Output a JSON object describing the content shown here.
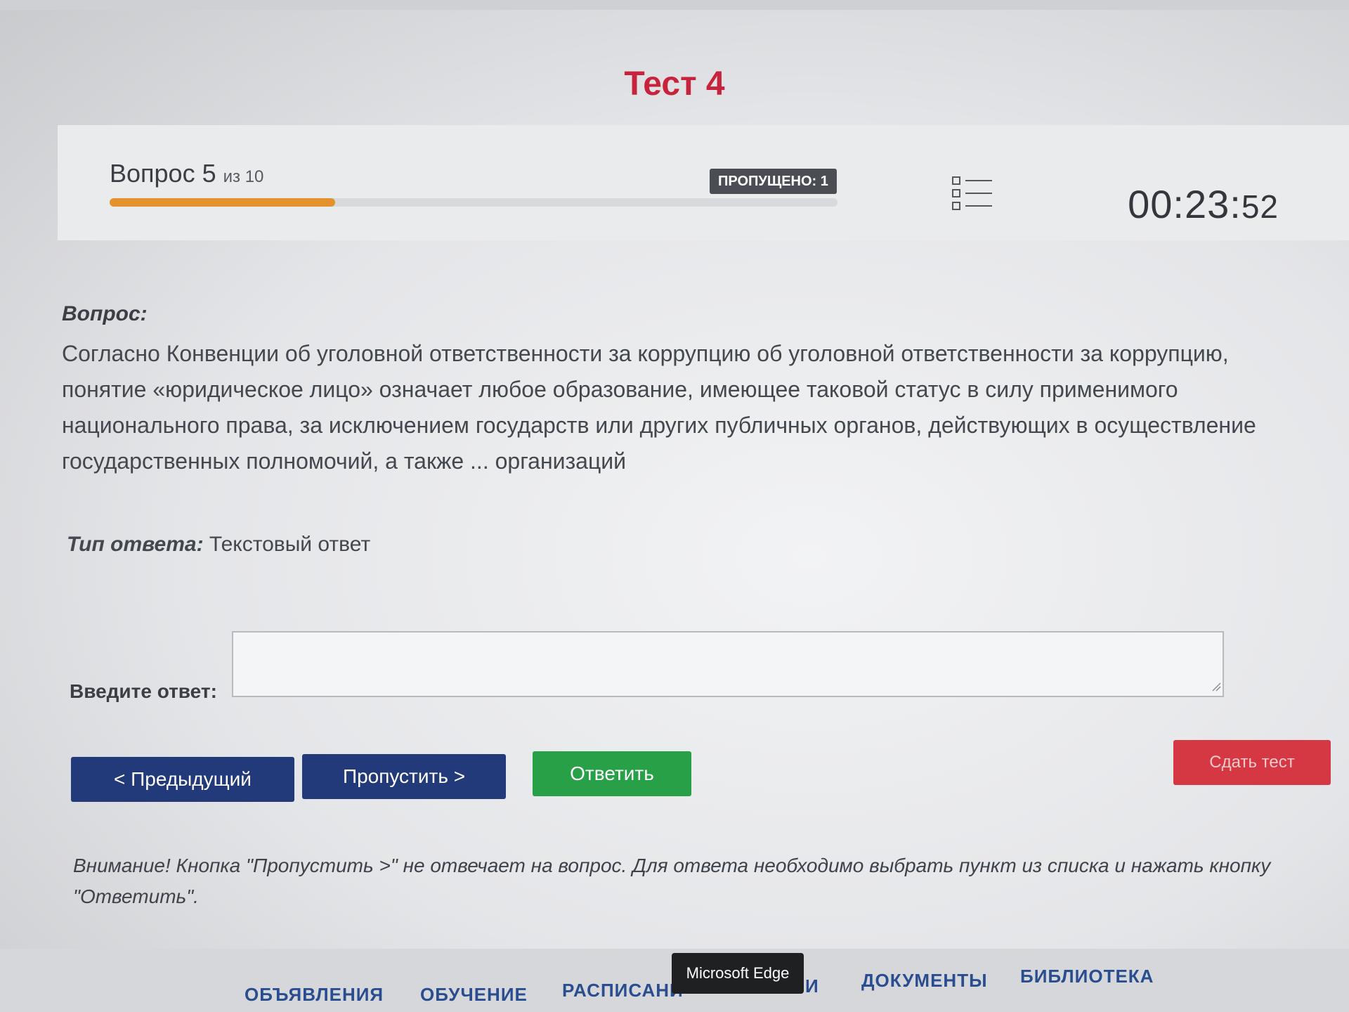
{
  "test": {
    "title": "Тест 4"
  },
  "progress": {
    "question_label": "Вопрос 5",
    "of_label": "из 10",
    "current": 5,
    "total": 10,
    "fill_fraction": 0.31,
    "skipped_label": "ПРОПУЩЕНО: 1",
    "timer_main": "00:23:",
    "timer_seconds": "52"
  },
  "question": {
    "label": "Вопрос:",
    "text": "Согласно Конвенции об уголовной ответственности за коррупцию об уголовной ответственности за коррупцию, понятие «юридическое лицо» означает любое образование, имеющее таковой статус в силу применимого национального права, за исключением государств или других публичных органов, действующих в осуществление государственных полномочий, а также ... организаций"
  },
  "answer": {
    "type_label": "Тип ответа:",
    "type_value": "Текстовый ответ",
    "input_label": "Введите ответ:",
    "input_value": ""
  },
  "buttons": {
    "prev": "< Предыдущий",
    "skip": "Пропустить >",
    "answer": "Ответить",
    "submit": "Сдать тест"
  },
  "warning": {
    "text": "Внимание! Кнопка \"Пропустить >\" не отвечает на вопрос. Для ответа необходимо выбрать пункт из списка и нажать кнопку \"Ответить\"."
  },
  "nav": {
    "items": [
      "ОБЪЯВЛЕНИЯ",
      "ОБУЧЕНИЕ",
      "РАСПИСАНИ",
      "И",
      "ДОКУМЕНТЫ",
      "БИБЛИОТЕКА"
    ]
  },
  "tooltip": {
    "text": "Microsoft Edge"
  },
  "colors": {
    "title": "#c8233c",
    "progress_fill": "#e3922d",
    "primary_button": "#233a7a",
    "answer_button": "#27a047",
    "submit_button": "#d63843",
    "nav_link": "#2a4d8f"
  }
}
